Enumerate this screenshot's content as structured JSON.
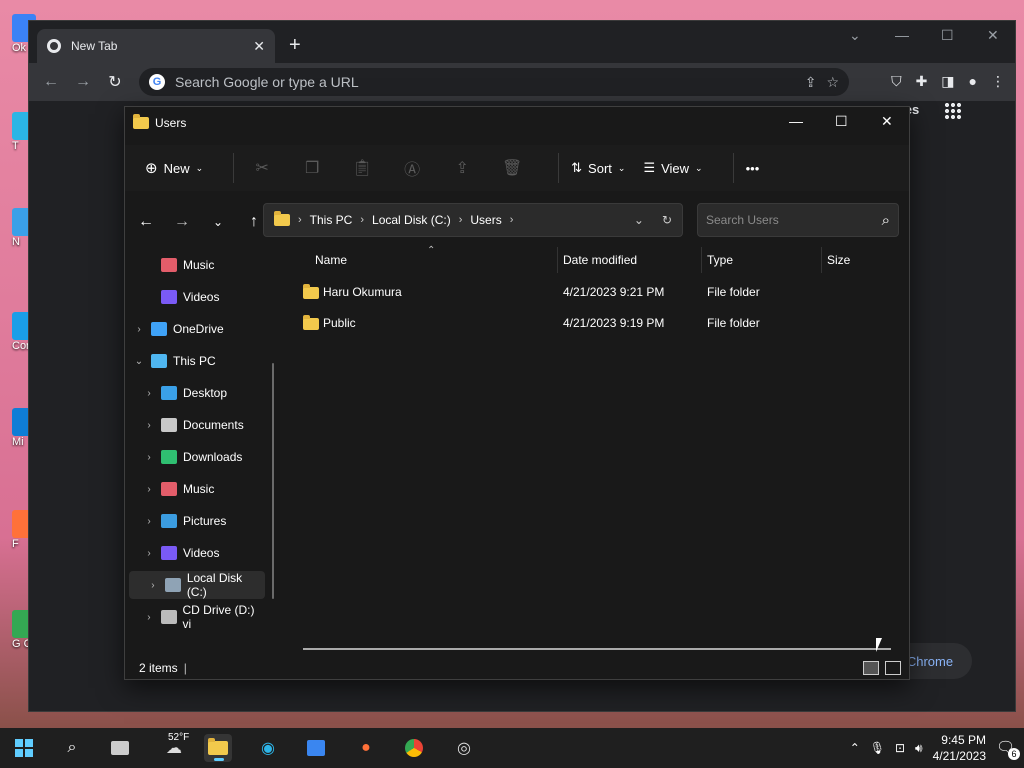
{
  "desktop": {
    "icons": [
      {
        "label": "Ok",
        "color": "#3b82f6"
      },
      {
        "label": "T",
        "color": "#2bb5e5"
      },
      {
        "label": "N",
        "color": "#3aa0e8"
      },
      {
        "label": "Cont",
        "color": "#1a9ee8"
      },
      {
        "label": "Mi",
        "color": "#0f7dd6"
      },
      {
        "label": "F",
        "color": "#ff7139"
      },
      {
        "label": "G C",
        "color": "#34a853"
      }
    ]
  },
  "chrome": {
    "tab_title": "New Tab",
    "omnibox_placeholder": "Search Google or type a URL",
    "right_link": "mages",
    "customize_label": "Customize Chrome"
  },
  "explorer": {
    "title": "Users",
    "commands": {
      "new": "New",
      "sort": "Sort",
      "view": "View",
      "more": "•••"
    },
    "breadcrumb": [
      "This PC",
      "Local Disk (C:)",
      "Users"
    ],
    "search_placeholder": "Search Users",
    "sidebar": [
      {
        "label": "Music",
        "icon": "music-icon",
        "indent": 1,
        "chevron": false
      },
      {
        "label": "Videos",
        "icon": "videos-icon",
        "indent": 1,
        "chevron": false
      },
      {
        "label": "OneDrive",
        "icon": "onedrive-icon",
        "indent": 0,
        "chevron": true
      },
      {
        "label": "This PC",
        "icon": "this-pc-icon",
        "indent": 0,
        "chevron": true,
        "expanded": true
      },
      {
        "label": "Desktop",
        "icon": "desktop-icon",
        "indent": 1,
        "chevron": true
      },
      {
        "label": "Documents",
        "icon": "documents-icon",
        "indent": 1,
        "chevron": true
      },
      {
        "label": "Downloads",
        "icon": "downloads-icon",
        "indent": 1,
        "chevron": true
      },
      {
        "label": "Music",
        "icon": "music-icon",
        "indent": 1,
        "chevron": true
      },
      {
        "label": "Pictures",
        "icon": "pictures-icon",
        "indent": 1,
        "chevron": true
      },
      {
        "label": "Videos",
        "icon": "videos-icon",
        "indent": 1,
        "chevron": true
      },
      {
        "label": "Local Disk (C:)",
        "icon": "drive-icon",
        "indent": 1,
        "chevron": true,
        "selected": true
      },
      {
        "label": "CD Drive (D:) vi",
        "icon": "cd-drive-icon",
        "indent": 1,
        "chevron": true
      }
    ],
    "columns": [
      "Name",
      "Date modified",
      "Type",
      "Size"
    ],
    "rows": [
      {
        "name": "Haru Okumura",
        "date": "4/21/2023 9:21 PM",
        "type": "File folder",
        "size": ""
      },
      {
        "name": "Public",
        "date": "4/21/2023 9:19 PM",
        "type": "File folder",
        "size": ""
      }
    ],
    "status": "2 items"
  },
  "taskbar": {
    "weather_temp": "52°F",
    "time": "9:45 PM",
    "date": "4/21/2023",
    "notification_count": "6"
  }
}
